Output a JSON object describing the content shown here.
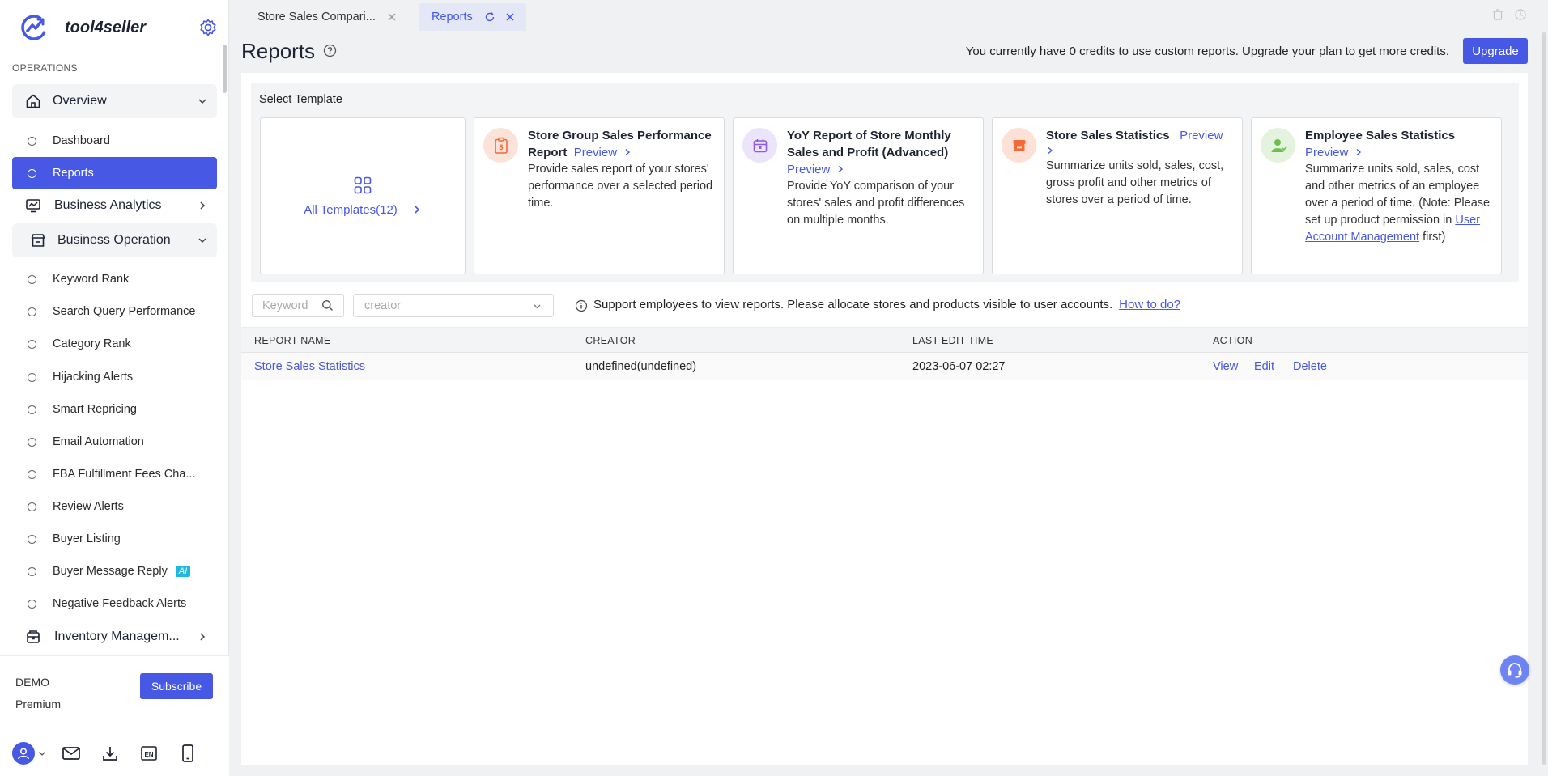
{
  "brand": {
    "name": "tool4seller"
  },
  "sidebar": {
    "section_label": "OPERATIONS",
    "overview": {
      "label": "Overview"
    },
    "overview_items": [
      {
        "label": "Dashboard"
      },
      {
        "label": "Reports"
      }
    ],
    "business_analytics": {
      "label": "Business Analytics"
    },
    "business_operation": {
      "label": "Business Operation"
    },
    "operation_items": [
      {
        "label": "Keyword Rank"
      },
      {
        "label": "Search Query Performance"
      },
      {
        "label": "Category Rank"
      },
      {
        "label": "Hijacking Alerts"
      },
      {
        "label": "Smart Repricing"
      },
      {
        "label": "Email Automation"
      },
      {
        "label": "FBA Fulfillment Fees Cha..."
      },
      {
        "label": "Review Alerts"
      },
      {
        "label": "Buyer Listing"
      },
      {
        "label": "Buyer Message Reply",
        "badge": "AI"
      },
      {
        "label": "Negative Feedback Alerts"
      }
    ],
    "inventory": {
      "label": "Inventory Managem..."
    },
    "footer": {
      "account": "DEMO",
      "plan": "Premium",
      "subscribe_label": "Subscribe",
      "lang_badge": "EN"
    }
  },
  "tabs": [
    {
      "label": "Store Sales Compari..."
    },
    {
      "label": "Reports"
    }
  ],
  "header": {
    "title": "Reports",
    "credits_notice": "You currently have 0 credits to use custom reports. Upgrade your plan to get more credits.",
    "upgrade_label": "Upgrade"
  },
  "templates": {
    "section_title": "Select Template",
    "all_label": "All Templates(12)",
    "preview_label": "Preview",
    "cards": [
      {
        "name": "Store Group Sales Performance Report",
        "desc": "Provide sales report of your stores' performance over a selected period time.",
        "icon": "clipboard-dollar-icon"
      },
      {
        "name": "YoY Report of Store Monthly Sales and Profit (Advanced)",
        "desc": "Provide YoY comparison of your stores' sales and profit differences on multiple months.",
        "icon": "calendar-icon"
      },
      {
        "name": "Store Sales Statistics",
        "desc": "Summarize units sold, sales, cost, gross profit and other metrics of stores over a period of time.",
        "icon": "store-icon"
      },
      {
        "name": "Employee Sales Statistics",
        "desc": "Summarize units sold, sales, cost and other metrics of an employee over a period of time. (Note: Please set up product permission in",
        "desc_link": "User Account Management",
        "desc_tail": "first)",
        "icon": "employee-icon"
      }
    ]
  },
  "filters": {
    "keyword_placeholder": "Keyword",
    "creator_placeholder": "creator",
    "info_text": "Support employees to view reports. Please allocate stores and products visible to user accounts.",
    "howto_label": "How to do?"
  },
  "table": {
    "columns": [
      "REPORT NAME",
      "CREATOR",
      "LAST EDIT TIME",
      "ACTION"
    ],
    "rows": [
      {
        "name": "Store Sales Statistics",
        "creator": "undefined(undefined)",
        "last_edit": "2023-06-07 02:27",
        "actions": [
          "View",
          "Edit",
          "Delete"
        ]
      }
    ]
  },
  "colors": {
    "accent": "#4658e4",
    "card_icon_1": "#fbe3d9",
    "card_icon_2": "#ece4fb",
    "card_icon_3": "#fde1d6",
    "card_icon_4": "#e4f3dd"
  }
}
